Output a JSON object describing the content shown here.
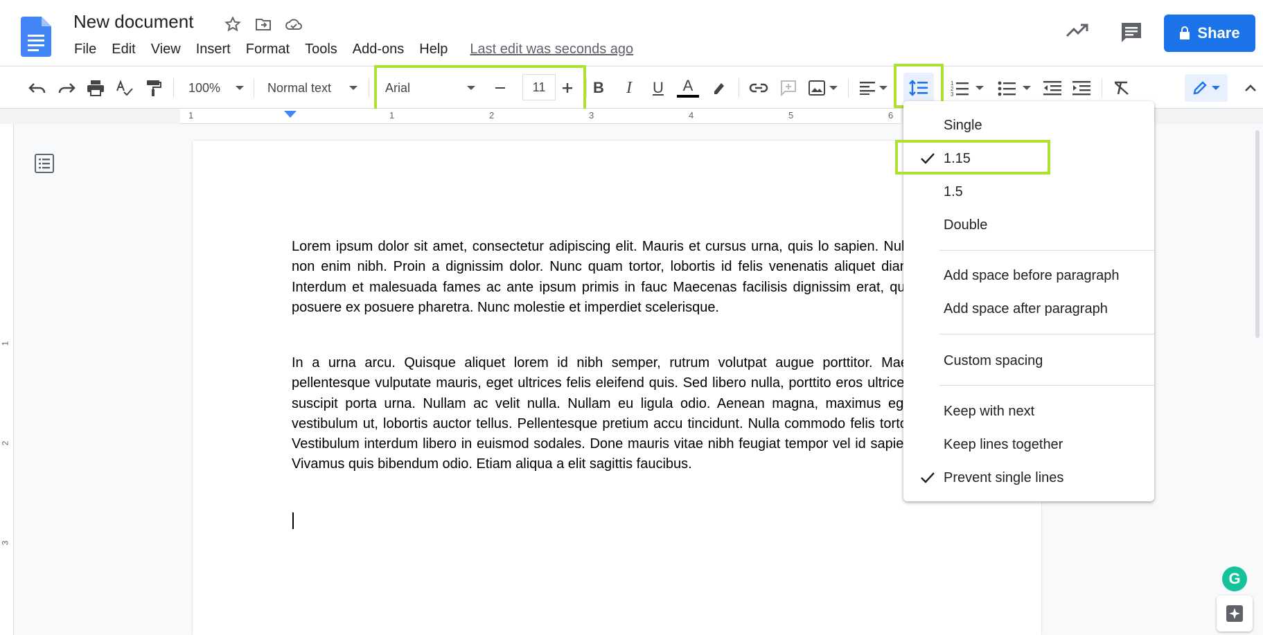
{
  "header": {
    "doc_title": "New document",
    "menu": [
      "File",
      "Edit",
      "View",
      "Insert",
      "Format",
      "Tools",
      "Add-ons",
      "Help"
    ],
    "last_edit": "Last edit was seconds ago",
    "share_label": "Share"
  },
  "toolbar": {
    "zoom": "100%",
    "style": "Normal text",
    "font": "Arial",
    "font_size": "11"
  },
  "ruler": {
    "numbers": [
      "1",
      "1",
      "2",
      "3",
      "4",
      "5",
      "6"
    ]
  },
  "vruler": {
    "numbers": [
      "1",
      "2",
      "3"
    ]
  },
  "document": {
    "paragraph_1": "Lorem ipsum dolor sit amet, consectetur adipiscing elit. Mauris et cursus urna, quis lo sapien. Nulla non enim nibh. Proin a dignissim dolor. Nunc quam tortor, lobortis id felis venenatis aliquet diam. Interdum et malesuada fames ac ante ipsum primis in fauc Maecenas facilisis dignissim erat, quis posuere ex posuere pharetra. Nunc molestie et imperdiet scelerisque.",
    "paragraph_2": "In a urna arcu. Quisque aliquet lorem id nibh semper, rutrum volutpat augue porttitor. Maec pellentesque vulputate mauris, eget ultrices felis eleifend quis. Sed libero nulla, porttito eros ultrices, suscipit porta urna. Nullam ac velit nulla. Nullam eu ligula odio. Aenean magna, maximus eget vestibulum ut, lobortis auctor tellus. Pellentesque pretium accu tincidunt. Nulla commodo felis tortor. Vestibulum interdum libero in euismod sodales. Done mauris vitae nibh feugiat tempor vel id sapien. Vivamus quis bibendum odio. Etiam aliqua a elit sagittis faucibus."
  },
  "spacing_menu": {
    "items": [
      {
        "label": "Single",
        "checked": false
      },
      {
        "label": "1.15",
        "checked": true
      },
      {
        "label": "1.5",
        "checked": false
      },
      {
        "label": "Double",
        "checked": false
      }
    ],
    "space_before": "Add space before paragraph",
    "space_after": "Add space after paragraph",
    "custom": "Custom spacing",
    "keep_next": "Keep with next",
    "keep_lines": "Keep lines together",
    "prevent_single": "Prevent single lines"
  },
  "colors": {
    "accent": "#1a73e8",
    "highlight": "#aee130",
    "grammarly": "#15c39a"
  }
}
